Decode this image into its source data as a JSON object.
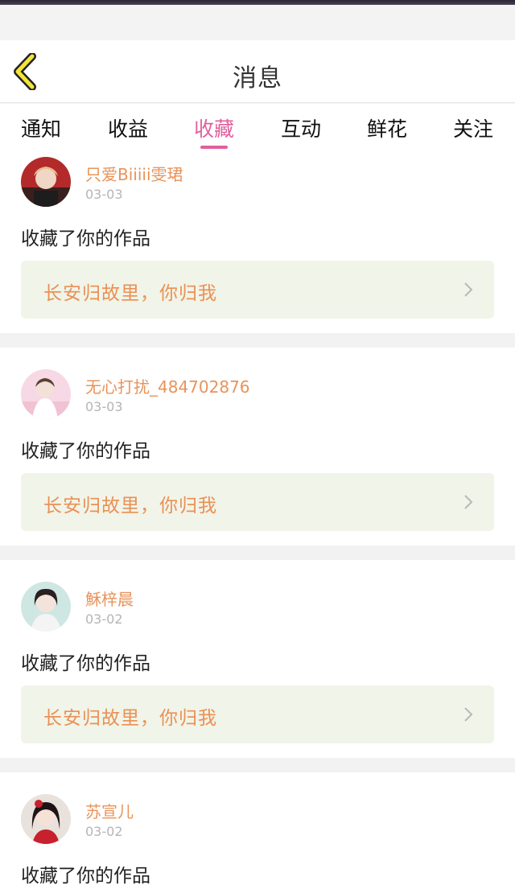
{
  "header": {
    "title": "消息",
    "back_icon": "chevron-left-icon"
  },
  "tabs": [
    {
      "label": "通知",
      "active": false
    },
    {
      "label": "收益",
      "active": false
    },
    {
      "label": "收藏",
      "active": true
    },
    {
      "label": "互动",
      "active": false
    },
    {
      "label": "鲜花",
      "active": false
    },
    {
      "label": "关注",
      "active": false
    }
  ],
  "colors": {
    "accent": "#e0609e",
    "username": "#e8935a",
    "work_title": "#ea9055",
    "work_bg": "#f1f4e8",
    "back_arrow": "#f3e43d"
  },
  "messages": [
    {
      "username": "只爱Biiiii雯珺",
      "date": "03-03",
      "action": "收藏了你的作品",
      "work_title": "长安归故里，你归我"
    },
    {
      "username": "无心打扰_484702876",
      "date": "03-03",
      "action": "收藏了你的作品",
      "work_title": "长安归故里，你归我"
    },
    {
      "username": "穌梓晨",
      "date": "03-02",
      "action": "收藏了你的作品",
      "work_title": "长安归故里，你归我"
    },
    {
      "username": "苏宣儿",
      "date": "03-02",
      "action": "收藏了你的作品"
    }
  ]
}
